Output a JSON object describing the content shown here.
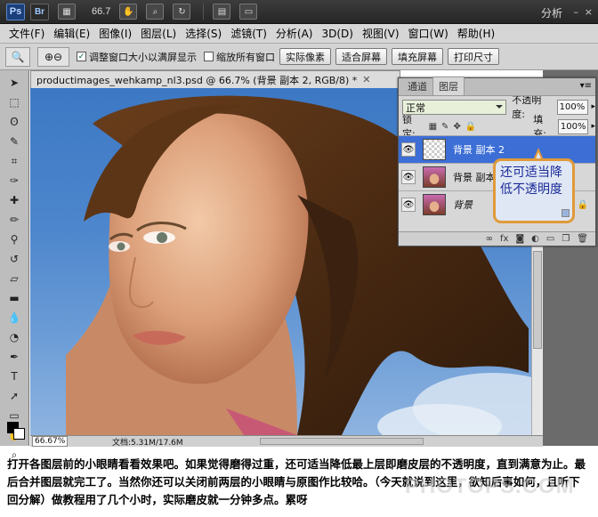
{
  "appbar": {
    "ps_logo": "Ps",
    "br_logo": "Br",
    "zoom": "66.7",
    "workspace": "分析",
    "min": "–",
    "close": "×",
    "icons": [
      "filmstrip-icon",
      "hand-icon",
      "zoom-icon",
      "rotate-icon",
      "arrange-icon",
      "screen-mode-icon"
    ]
  },
  "menubar": {
    "items": [
      "文件(F)",
      "编辑(E)",
      "图像(I)",
      "图层(L)",
      "选择(S)",
      "滤镜(T)",
      "分析(A)",
      "3D(D)",
      "视图(V)",
      "窗口(W)",
      "帮助(H)"
    ]
  },
  "options": {
    "resize_windows": "调整窗口大小以满屏显示",
    "zoom_all": "缩放所有窗口",
    "actual_pixels": "实际像素",
    "fit_screen": "适合屏幕",
    "fill_screen": "填充屏幕",
    "print_size": "打印尺寸"
  },
  "document": {
    "tab_title": "productimages_wehkamp_nl3.psd @ 66.7% (背景 副本 2, RGB/8) *",
    "status_zoom": "66.67%",
    "status_doc": "文档:5.31M/17.6M"
  },
  "layers_panel": {
    "tab_channels": "通道",
    "tab_layers": "图层",
    "blend_mode": "正常",
    "opacity_label": "不透明度:",
    "opacity_value": "100%",
    "lock_label": "锁定:",
    "fill_label": "填充:",
    "fill_value": "100%",
    "layers": [
      {
        "name": "背景 副本 2",
        "selected": true
      },
      {
        "name": "背景 副本",
        "selected": false
      },
      {
        "name": "背景",
        "selected": false
      }
    ]
  },
  "callout": {
    "text": "还可适当降低不透明度"
  },
  "caption": {
    "text": "打开各图层前的小眼睛看看效果吧。如果觉得磨得过重，还可适当降低最上层即磨皮层的不透明度，直到满意为止。最后合并图层就完工了。当然你还可以关闭前两层的小眼睛与原图作比较哈。（今天就说到这里，欲知后事如何，且听下回分解）做教程用了几个小时，实际磨皮就一分钟多点。累呀"
  },
  "watermark": "PHOTOPS.COM",
  "colors": {
    "selection_blue": "#3c6ed6",
    "callout_border": "#e09a39",
    "callout_text": "#1b2a99"
  }
}
